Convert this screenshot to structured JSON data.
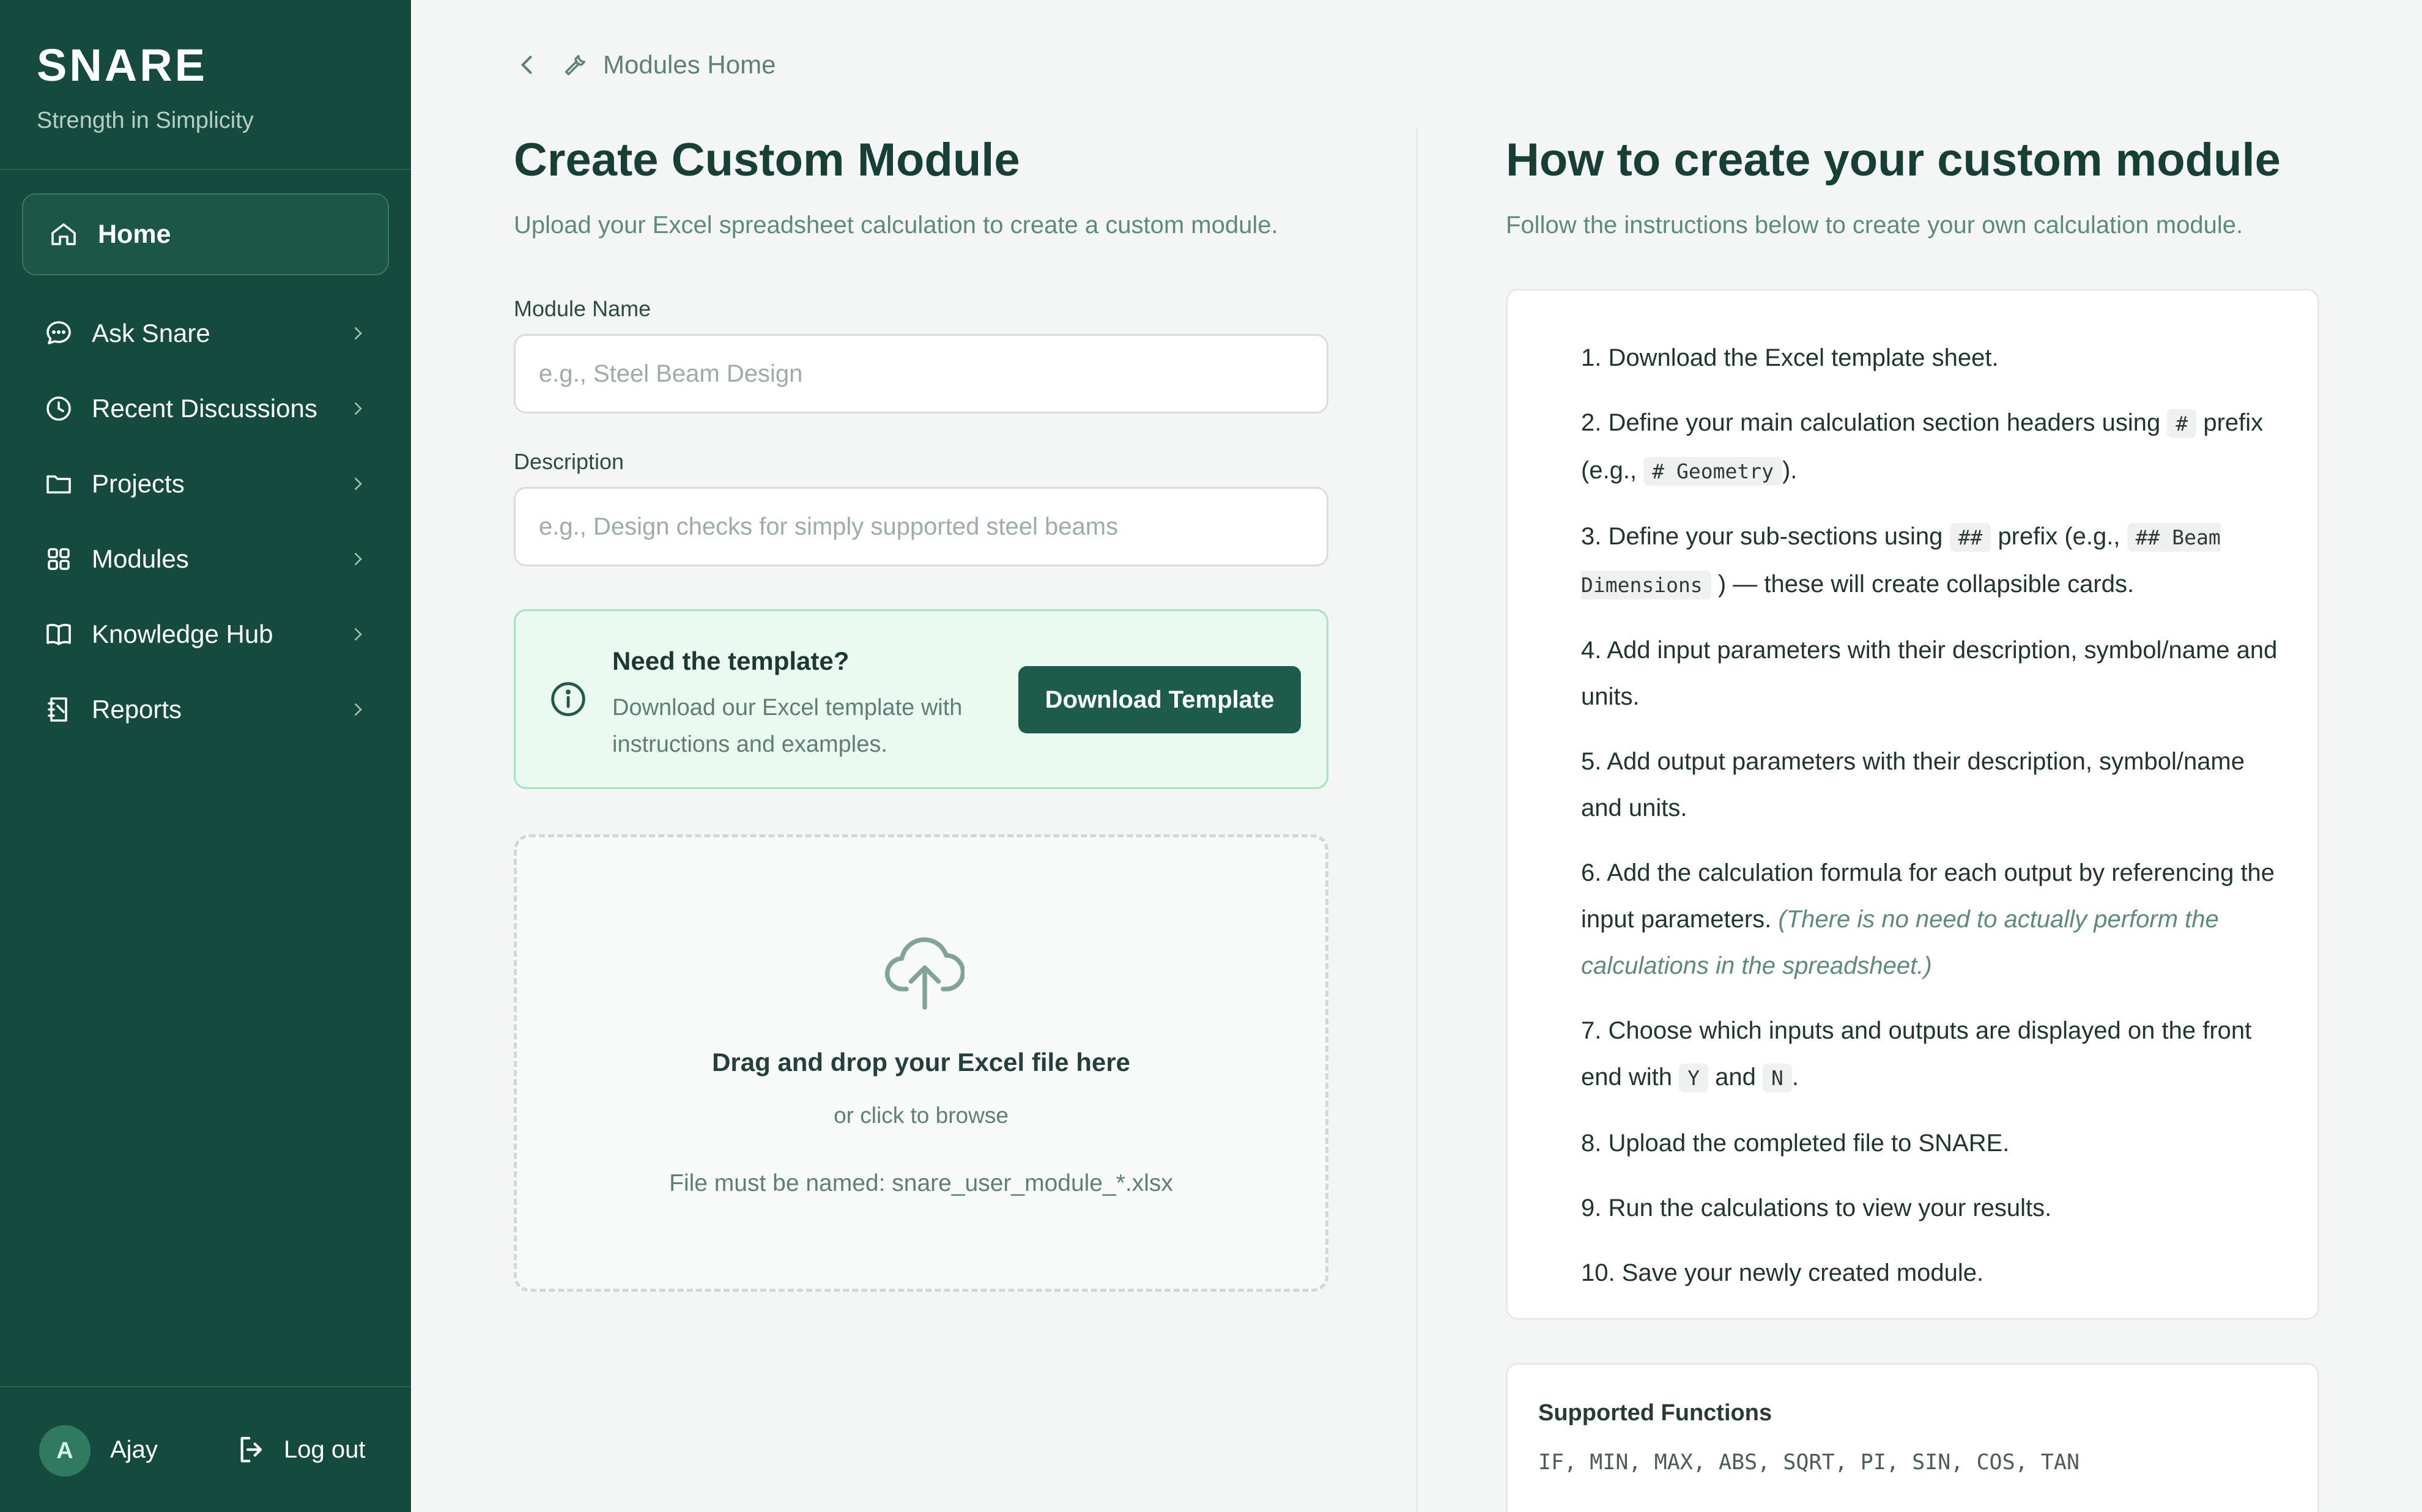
{
  "sidebar": {
    "brand": "SNARE",
    "tagline": "Strength in Simplicity",
    "items": [
      {
        "label": "Home",
        "icon": "home-icon"
      },
      {
        "label": "Ask Snare",
        "icon": "chat-bubble-icon"
      },
      {
        "label": "Recent Discussions",
        "icon": "clock-icon"
      },
      {
        "label": "Projects",
        "icon": "folder-icon"
      },
      {
        "label": "Modules",
        "icon": "grid-icon"
      },
      {
        "label": "Knowledge Hub",
        "icon": "book-icon"
      },
      {
        "label": "Reports",
        "icon": "notebook-icon"
      }
    ],
    "user": {
      "initial": "A",
      "name": "Ajay"
    },
    "logout_label": "Log out"
  },
  "breadcrumb": {
    "label": "Modules Home"
  },
  "form": {
    "title": "Create Custom Module",
    "subtitle": "Upload your Excel spreadsheet calculation to create a custom module.",
    "module_name": {
      "label": "Module Name",
      "value": "",
      "placeholder": "e.g., Steel Beam Design"
    },
    "description": {
      "label": "Description",
      "value": "",
      "placeholder": "e.g., Design checks for simply supported steel beams"
    },
    "template": {
      "title": "Need the template?",
      "text": "Download our Excel template with instructions and examples.",
      "button": "Download Template"
    },
    "dropzone": {
      "title": "Drag and drop your Excel file here",
      "subtitle": "or click to browse",
      "note": "File must be named: snare_user_module_*.xlsx"
    }
  },
  "howto": {
    "title": "How to create your custom module",
    "subtitle": "Follow the instructions below to create your own calculation module.",
    "steps": {
      "s1": "1. Download the Excel template sheet.",
      "s2a": "2. Define your main calculation section headers using",
      "s2code1": "#",
      "s2b": "prefix (e.g.,",
      "s2code2": "# Geometry",
      "s2c": ").",
      "s3a": "3. Define your sub-sections using",
      "s3code1": "##",
      "s3b": "prefix (e.g.,",
      "s3code2": "## Beam Dimensions",
      "s3c": ") — these will create collapsible cards.",
      "s4": "4. Add input parameters with their description, symbol/name and units.",
      "s5": "5. Add output parameters with their description, symbol/name and units.",
      "s6a": "6. Add the calculation formula for each output by referencing the input parameters.",
      "s6note": "(There is no need to actually perform the calculations in the spreadsheet.)",
      "s7a": "7. Choose which inputs and outputs are displayed on the front end with",
      "s7code1": "Y",
      "s7b": "and",
      "s7code2": "N",
      "s7c": ".",
      "s8": "8. Upload the completed file to SNARE.",
      "s9": "9. Run the calculations to view your results.",
      "s10": "10. Save your newly created module."
    },
    "functions": {
      "title": "Supported Functions",
      "list": "IF, MIN, MAX, ABS, SQRT, PI, SIN, COS, TAN"
    }
  },
  "colors": {
    "sidebar_bg": "#154b3e",
    "accent": "#1d5c4a",
    "template_bg": "#ebfaf1"
  }
}
